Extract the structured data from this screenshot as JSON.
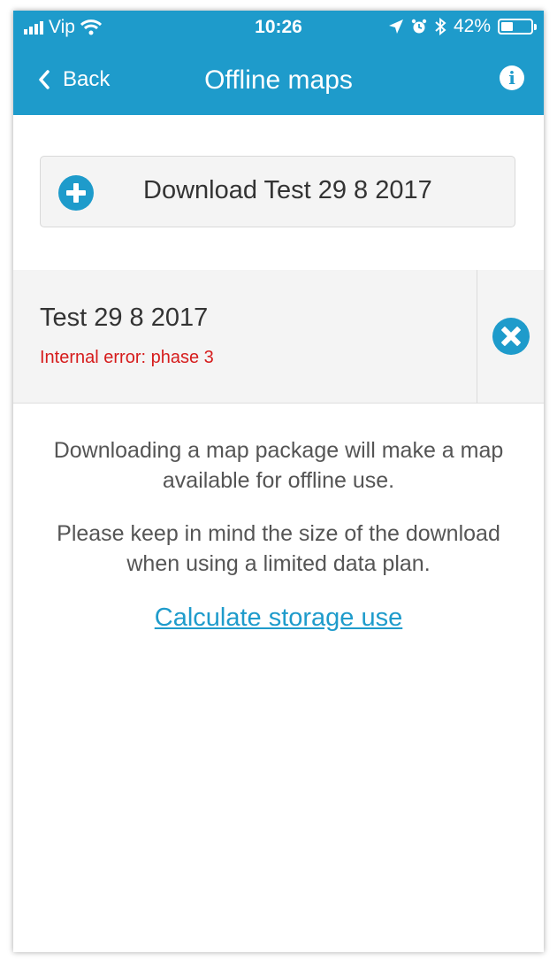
{
  "status": {
    "carrier": "Vip",
    "time": "10:26",
    "battery_percent": "42%",
    "battery_level": 0.42
  },
  "nav": {
    "back_label": "Back",
    "title": "Offline maps"
  },
  "download_button": {
    "label": "Download Test 29 8 2017"
  },
  "map_item": {
    "name": "Test 29 8 2017",
    "error": "Internal error: phase 3"
  },
  "info_text": {
    "paragraph1": "Downloading a map package will make a map available for offline use.",
    "paragraph2": "Please keep in mind the size of the download when using a limited data plan."
  },
  "storage_link": "Calculate storage use",
  "colors": {
    "accent": "#1e9bcb",
    "error": "#d61c1c"
  },
  "icons": [
    "signal-icon",
    "wifi-icon",
    "location-icon",
    "alarm-icon",
    "bluetooth-icon",
    "battery-icon",
    "chevron-left-icon",
    "info-icon",
    "plus-circle-icon",
    "remove-circle-icon"
  ]
}
